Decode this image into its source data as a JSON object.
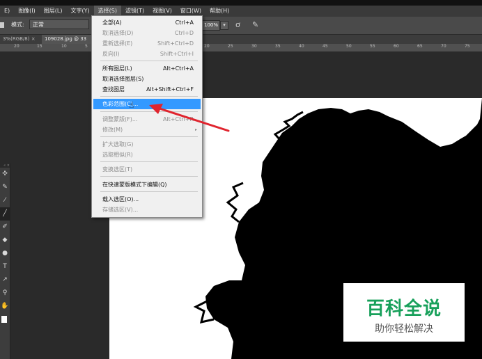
{
  "menubar": {
    "items": [
      "E)",
      "图像(I)",
      "图层(L)",
      "文字(Y)",
      "选择(S)",
      "滤镜(T)",
      "视图(V)",
      "窗口(W)",
      "帮助(H)"
    ],
    "active_index": 4
  },
  "options": {
    "mode_label": "模式:",
    "mode_value": "正常",
    "opacity": "100%",
    "opacity_arrow": "▾",
    "flow_icon": "airbrush-icon",
    "pen_icon": "pressure-icon"
  },
  "tabs": {
    "tab1": "3%(RGB/8) ×",
    "tab2": "109028.jpg @ 33"
  },
  "ruler": {
    "left_ticks": [
      "20",
      "15",
      "10",
      "5"
    ],
    "right_ticks": [
      "20",
      "25",
      "30",
      "35",
      "40",
      "45",
      "50",
      "55",
      "60",
      "65",
      "70",
      "75"
    ]
  },
  "select_menu": {
    "items": [
      {
        "label": "全部(A)",
        "shortcut": "Ctrl+A",
        "disabled": false
      },
      {
        "label": "取消选择(D)",
        "shortcut": "Ctrl+D",
        "disabled": true
      },
      {
        "label": "重新选择(E)",
        "shortcut": "Shift+Ctrl+D",
        "disabled": true
      },
      {
        "label": "反向(I)",
        "shortcut": "Shift+Ctrl+I",
        "disabled": true
      },
      {
        "label": "所有图层(L)",
        "shortcut": "Alt+Ctrl+A",
        "disabled": false
      },
      {
        "label": "取消选择图层(S)",
        "shortcut": "",
        "disabled": false
      },
      {
        "label": "查找图层",
        "shortcut": "Alt+Shift+Ctrl+F",
        "disabled": false
      },
      {
        "label": "色彩范围(C)...",
        "shortcut": "",
        "disabled": false,
        "highlighted": true
      },
      {
        "label": "调整蒙版(F)...",
        "shortcut": "Alt+Ctrl+R",
        "disabled": true
      },
      {
        "label": "修改(M)",
        "shortcut": "",
        "disabled": true,
        "submenu": true
      },
      {
        "label": "扩大选取(G)",
        "shortcut": "",
        "disabled": true
      },
      {
        "label": "选取相似(R)",
        "shortcut": "",
        "disabled": true
      },
      {
        "label": "变换选区(T)",
        "shortcut": "",
        "disabled": true
      },
      {
        "label": "在快速蒙版模式下编辑(Q)",
        "shortcut": "",
        "disabled": false
      },
      {
        "label": "载入选区(O)...",
        "shortcut": "",
        "disabled": false
      },
      {
        "label": "存储选区(V)...",
        "shortcut": "",
        "disabled": true
      }
    ],
    "submenu_arrow": "▸"
  },
  "toolbox": {
    "tools": [
      "move-icon",
      "brush-icon",
      "eyedropper-icon",
      "line-icon",
      "pencil-icon",
      "bucket-icon",
      "dodge-icon",
      "type-icon",
      "path-select-icon",
      "zoom-icon",
      "hand-icon"
    ],
    "glyphs": [
      "✣",
      "✎",
      "⁄",
      "╱",
      "✐",
      "◆",
      "●",
      "T",
      "↗",
      "⚲",
      "✋"
    ],
    "head": "« ×"
  },
  "watermark": {
    "title": "百科全说",
    "subtitle": "助你轻松解决"
  },
  "colors": {
    "highlight": "#3399ff",
    "annotation_arrow": "#e0242e",
    "watermark_green": "#17a05a"
  }
}
